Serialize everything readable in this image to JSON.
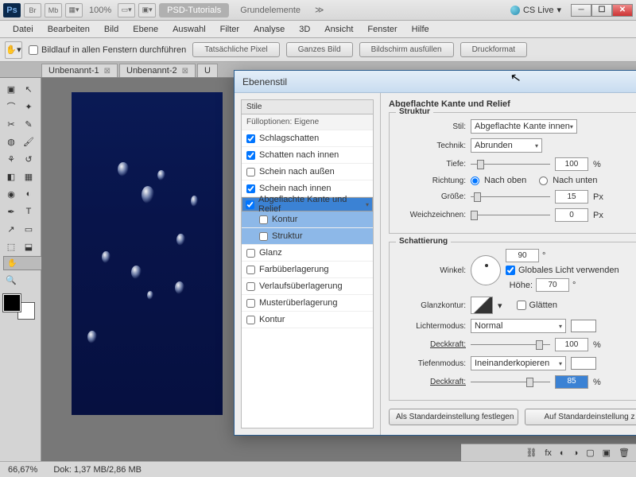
{
  "topbar": {
    "ps": "Ps",
    "br": "Br",
    "mb": "Mb",
    "zoom": "100%",
    "tabs": [
      "PSD-Tutorials",
      "Grundelemente"
    ],
    "cslive": "CS Live"
  },
  "menu": [
    "Datei",
    "Bearbeiten",
    "Bild",
    "Ebene",
    "Auswahl",
    "Filter",
    "Analyse",
    "3D",
    "Ansicht",
    "Fenster",
    "Hilfe"
  ],
  "optbar": {
    "scroll_all": "Bildlauf in allen Fenstern durchführen",
    "btns": [
      "Tatsächliche Pixel",
      "Ganzes Bild",
      "Bildschirm ausfüllen",
      "Druckformat"
    ]
  },
  "doctabs": [
    "Unbenannt-1",
    "Unbenannt-2",
    "U"
  ],
  "status": {
    "zoom": "66,67%",
    "doc": "Dok: 1,37 MB/2,86 MB"
  },
  "dialog": {
    "title": "Ebenenstil",
    "stile_hdr": "Stile",
    "styles": [
      {
        "label": "Fülloptionen: Eigene",
        "type": "hdr"
      },
      {
        "label": "Schlagschatten",
        "checked": true
      },
      {
        "label": "Schatten nach innen",
        "checked": true
      },
      {
        "label": "Schein nach außen",
        "checked": false
      },
      {
        "label": "Schein nach innen",
        "checked": true
      },
      {
        "label": "Abgeflachte Kante und Relief",
        "checked": true,
        "sel": true
      },
      {
        "label": "Kontur",
        "sub": true,
        "checked": false
      },
      {
        "label": "Struktur",
        "sub": true,
        "checked": false
      },
      {
        "label": "Glanz",
        "checked": false
      },
      {
        "label": "Farbüberlagerung",
        "checked": false
      },
      {
        "label": "Verlaufsüberlagerung",
        "checked": false
      },
      {
        "label": "Musterüberlagerung",
        "checked": false
      },
      {
        "label": "Kontur",
        "checked": false
      }
    ],
    "section_main": "Abgeflachte Kante und Relief",
    "struktur": {
      "legend": "Struktur",
      "stil_l": "Stil:",
      "stil_v": "Abgeflachte Kante innen",
      "technik_l": "Technik:",
      "technik_v": "Abrunden",
      "tiefe_l": "Tiefe:",
      "tiefe_v": "100",
      "tiefe_u": "%",
      "richtung_l": "Richtung:",
      "oben": "Nach oben",
      "unten": "Nach unten",
      "groesse_l": "Größe:",
      "groesse_v": "15",
      "px": "Px",
      "weich_l": "Weichzeichnen:",
      "weich_v": "0"
    },
    "schatt": {
      "legend": "Schattierung",
      "winkel_l": "Winkel:",
      "winkel_v": "90",
      "deg": "°",
      "global": "Globales Licht verwenden",
      "hoehe_l": "Höhe:",
      "hoehe_v": "70",
      "glanz_l": "Glanzkontur:",
      "glaetten": "Glätten",
      "licht_l": "Lichtermodus:",
      "licht_v": "Normal",
      "deck_l": "Deckkraft:",
      "deck1_v": "100",
      "tiefen_l": "Tiefenmodus:",
      "tiefen_v": "Ineinanderkopieren",
      "deck2_v": "85",
      "pct": "%"
    },
    "btns": [
      "Als Standardeinstellung festlegen",
      "Auf Standardeinstellung z"
    ]
  }
}
